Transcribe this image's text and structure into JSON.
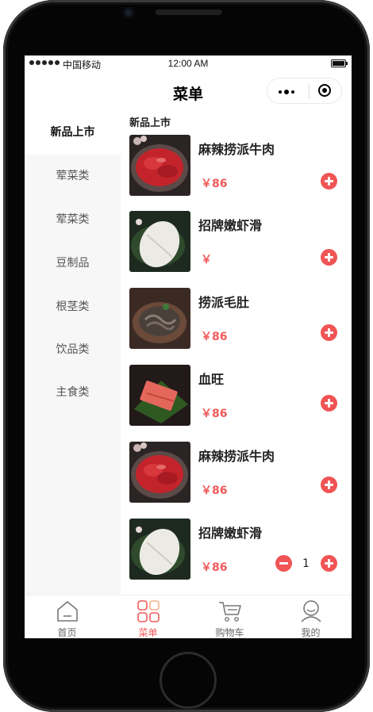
{
  "status_bar": {
    "carrier": "中国移动",
    "time": "12:00 AM"
  },
  "nav": {
    "title": "菜单"
  },
  "sidebar": {
    "items": [
      {
        "label": "新品上市"
      },
      {
        "label": "荤菜类"
      },
      {
        "label": "荤菜类"
      },
      {
        "label": "豆制品"
      },
      {
        "label": "根茎类"
      },
      {
        "label": "饮品类"
      },
      {
        "label": "主食类"
      }
    ],
    "active_index": 0
  },
  "content": {
    "section_title": "新品上市",
    "items": [
      {
        "name": "麻辣捞派牛肉",
        "price": "￥86",
        "image": "beef"
      },
      {
        "name": "招牌嫩虾滑",
        "price": "￥",
        "image": "shrimp"
      },
      {
        "name": "捞派毛肚",
        "price": "￥86",
        "image": "tripe"
      },
      {
        "name": "血旺",
        "price": "￥86",
        "image": "blood"
      },
      {
        "name": "麻辣捞派牛肉",
        "price": "￥86",
        "image": "beef"
      },
      {
        "name": "招牌嫩虾滑",
        "price": "￥86",
        "image": "shrimp",
        "quantity": "1"
      }
    ]
  },
  "tab_bar": {
    "tabs": [
      {
        "label": "首页",
        "icon": "home-icon"
      },
      {
        "label": "菜单",
        "icon": "grid-menu-icon"
      },
      {
        "label": "购物车",
        "icon": "cart-icon"
      },
      {
        "label": "我的",
        "icon": "profile-icon"
      }
    ],
    "active_index": 1
  },
  "colors": {
    "accent": "#f15b5b",
    "sidebar_bg": "#f7f7f7"
  }
}
